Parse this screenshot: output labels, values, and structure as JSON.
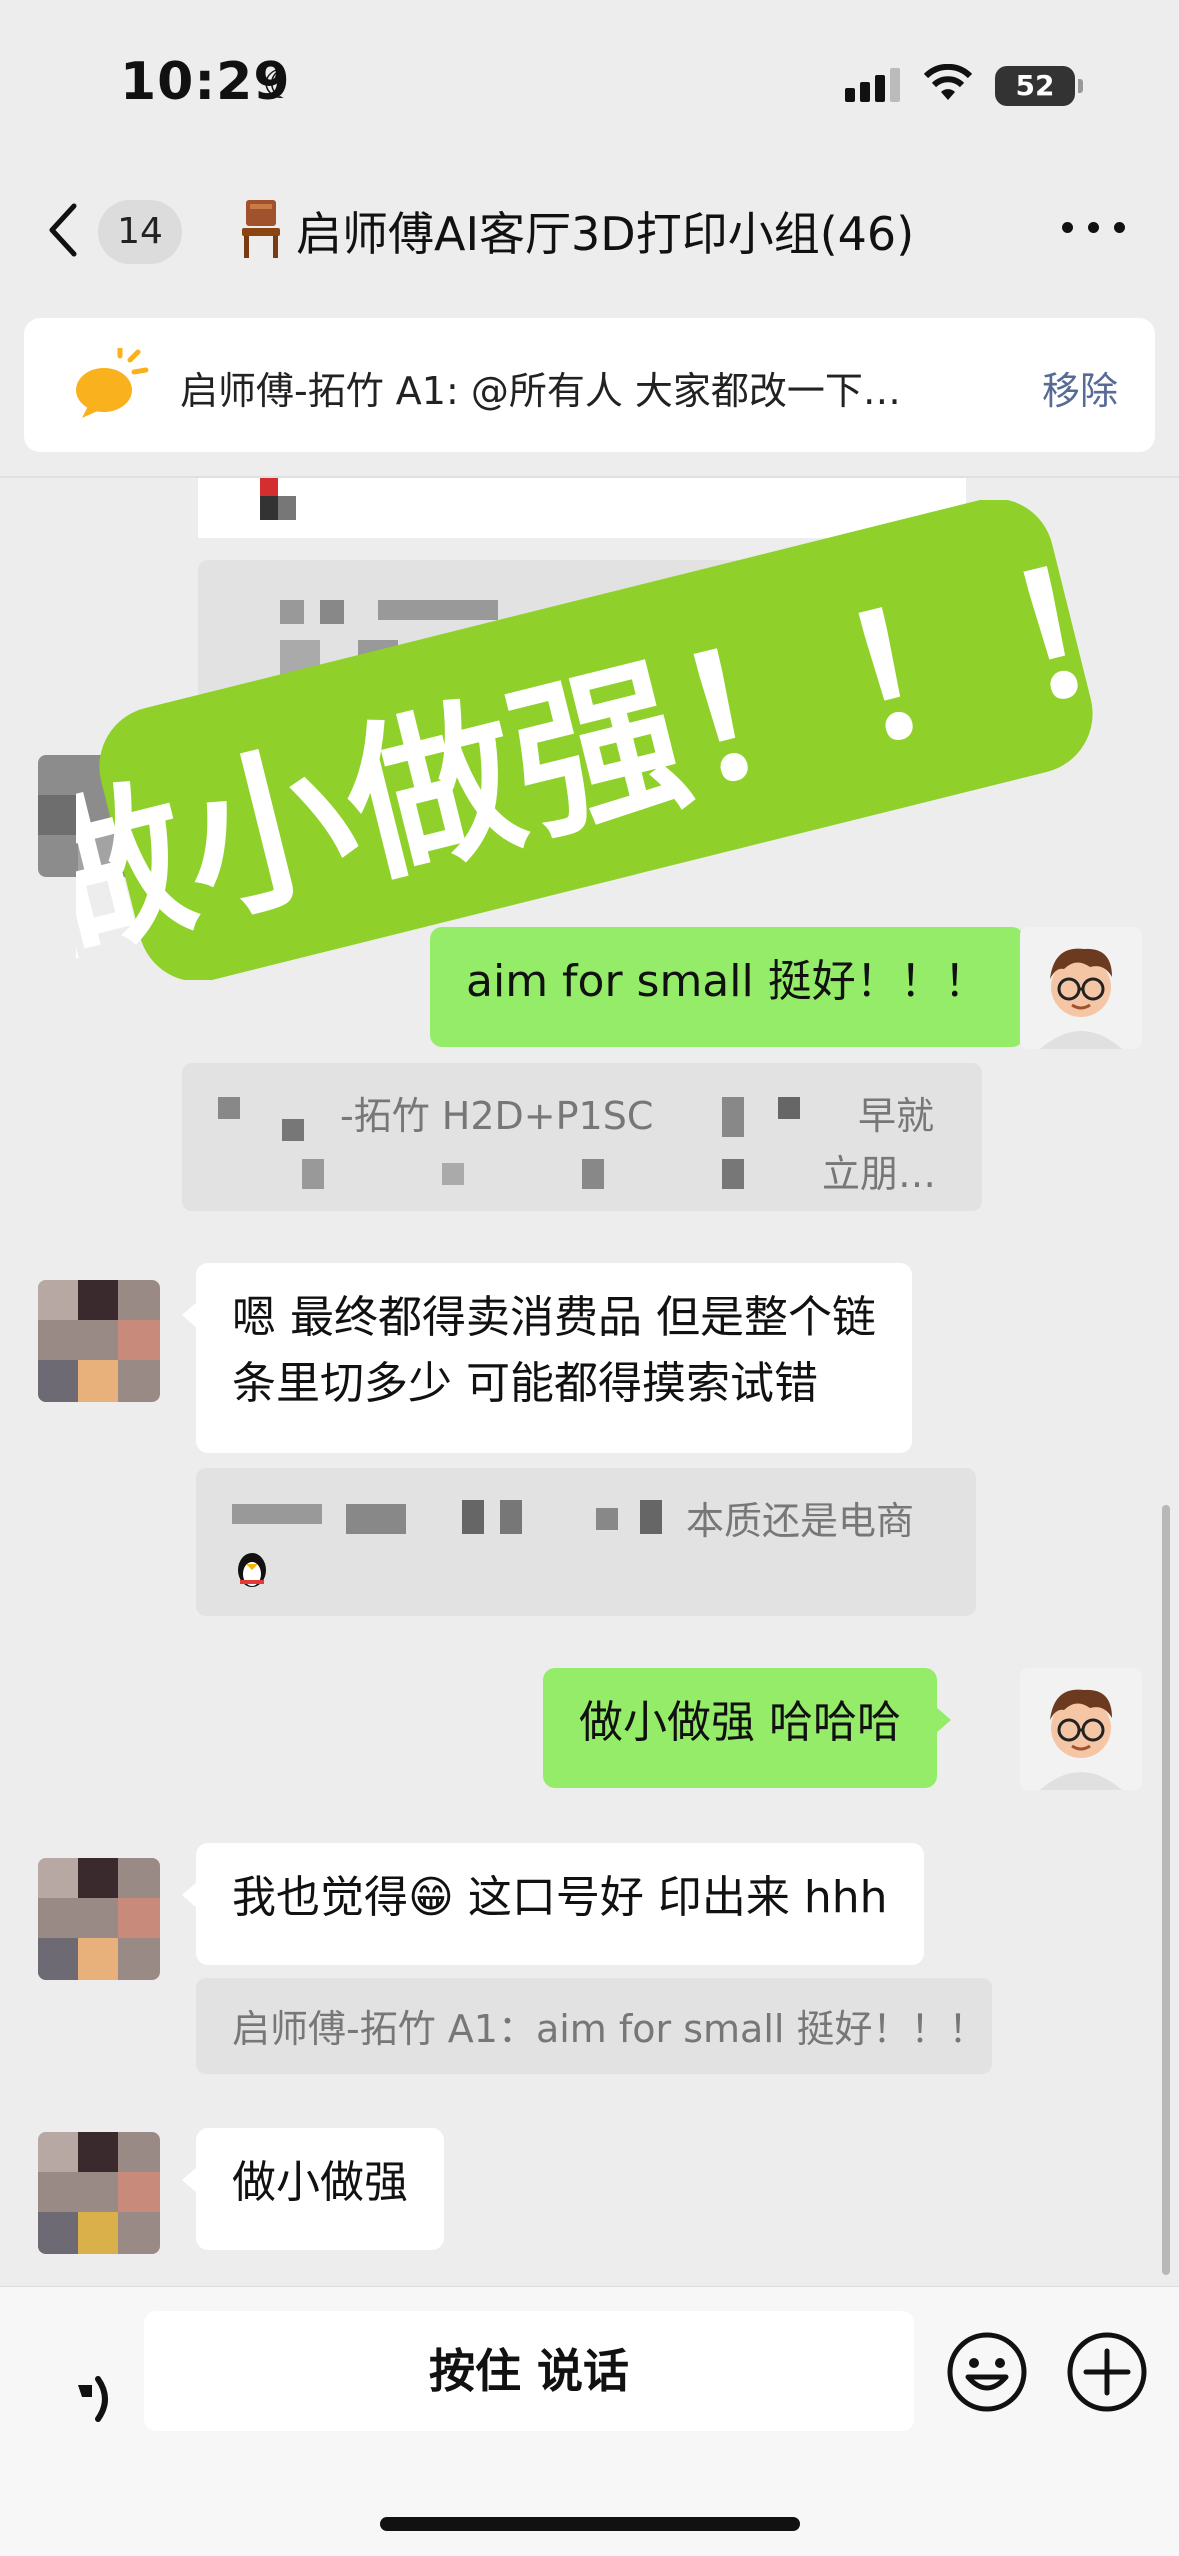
{
  "status_bar": {
    "time": "10:29",
    "battery": "52"
  },
  "header": {
    "back_badge": "14",
    "title": "启师傅AI客厅3D打印小组(46)"
  },
  "pinned_notice": {
    "text": "启师傅-拓竹 A1: @所有人 大家都改一下…",
    "remove_label": "移除"
  },
  "sticker": {
    "text": "做小做强！！！",
    "color": "#8fd12a"
  },
  "messages": [
    {
      "side": "me",
      "text": "aim for small 挺好！！！"
    },
    {
      "side": "quote",
      "text": "-拓竹 H2D+P1SC",
      "text_right_1": "早就",
      "text_right_2": "立朋…"
    },
    {
      "side": "other",
      "line1": "嗯 最终都得卖消费品 但是整个链",
      "line2": "条里切多少 可能都得摸索试错"
    },
    {
      "side": "quote",
      "text": "本质还是电商"
    },
    {
      "side": "me",
      "text": "做小做强 哈哈哈"
    },
    {
      "side": "other",
      "text_before_emoji": "我也觉得",
      "emoji": "😁",
      "text_after_emoji": " 这口号好 印出来 hhh"
    },
    {
      "side": "quote",
      "text": "启师傅-拓竹 A1：aim for small 挺好！！！"
    },
    {
      "side": "other",
      "text": "做小做强"
    }
  ],
  "input_bar": {
    "hold_to_talk": "按住 说话"
  },
  "colors": {
    "chat_bg": "#ededed",
    "my_bubble": "#95ec69",
    "link_blue": "#576b95"
  }
}
